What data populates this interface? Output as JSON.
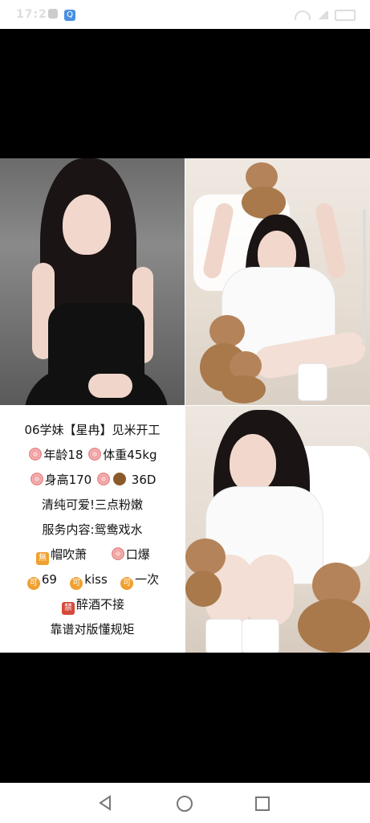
{
  "status": {
    "time": "17:21",
    "app_badge": "Q"
  },
  "poster": {
    "lines": [
      "06学妹【星冉】见米开工",
      "年龄18",
      "体重45kg",
      "身高170",
      "36D",
      "清纯可爱!三点粉嫩",
      "服务内容:鸳鸯戏水",
      "帽吹萧",
      "口爆",
      "69",
      "kiss",
      "一次",
      "醉酒不接",
      "靠谱对版懂规矩"
    ],
    "badges": {
      "no_char": "無",
      "ke_char": "可",
      "jin_char": "禁"
    }
  },
  "nav": {
    "back_icon": "back-triangle-icon",
    "home_icon": "home-circle-icon",
    "recent_icon": "recent-square-icon"
  }
}
